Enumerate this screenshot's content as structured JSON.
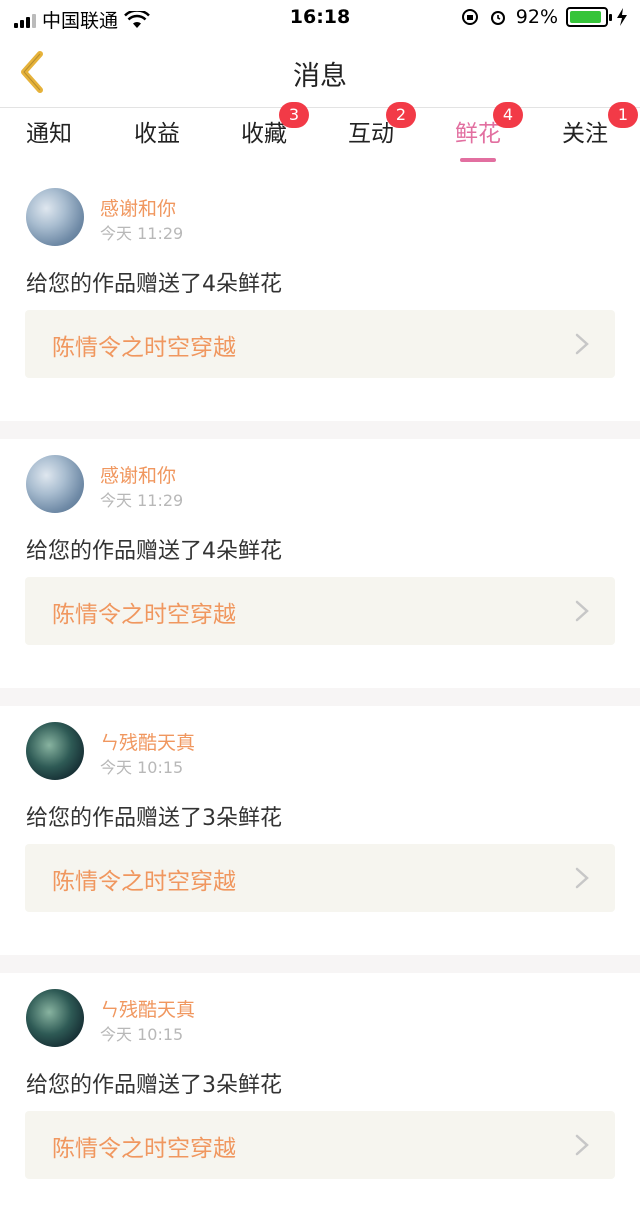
{
  "status_bar": {
    "carrier": "中国联通",
    "time": "16:18",
    "battery_percent": "92%",
    "battery_level": 0.92
  },
  "nav": {
    "title": "消息"
  },
  "tabs": [
    {
      "label": "通知",
      "badge": ""
    },
    {
      "label": "收益",
      "badge": ""
    },
    {
      "label": "收藏",
      "badge": "3"
    },
    {
      "label": "互动",
      "badge": "2"
    },
    {
      "label": "鲜花",
      "badge": "4"
    },
    {
      "label": "关注",
      "badge": "1"
    }
  ],
  "feed": [
    {
      "user": "感谢和你",
      "time": "今天 11:29",
      "message": "给您的作品赠送了4朵鲜花",
      "work": "陈情令之时空穿越"
    },
    {
      "user": "感谢和你",
      "time": "今天 11:29",
      "message": "给您的作品赠送了4朵鲜花",
      "work": "陈情令之时空穿越"
    },
    {
      "user": "ㄣ残酷天真",
      "time": "今天 10:15",
      "message": "给您的作品赠送了3朵鲜花",
      "work": "陈情令之时空穿越"
    },
    {
      "user": "ㄣ残酷天真",
      "time": "今天 10:15",
      "message": "给您的作品赠送了3朵鲜花",
      "work": "陈情令之时空穿越"
    }
  ],
  "colors": {
    "accent_pink": "#e26fa0",
    "orange_text": "#f0975f",
    "badge_red": "#f23a47",
    "back_arrow": "#e6b23a"
  }
}
